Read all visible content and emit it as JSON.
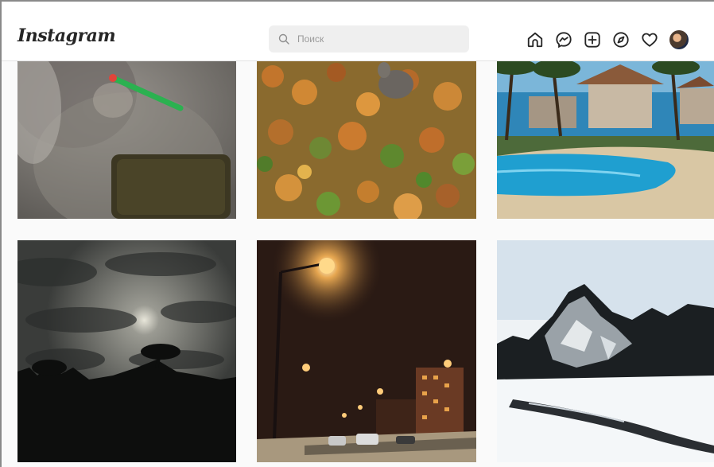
{
  "header": {
    "logo_text": "Instagram",
    "search_placeholder": "Поиск",
    "nav_icons": [
      "home-icon",
      "messenger-icon",
      "new-post-icon",
      "explore-icon",
      "activity-heart-icon",
      "profile-avatar"
    ]
  },
  "posts": [
    {
      "subject": "cat-with-pen"
    },
    {
      "subject": "autumn-leaves-squirrel"
    },
    {
      "subject": "tropical-pool-resort"
    },
    {
      "subject": "cloudy-night-sky-palms"
    },
    {
      "subject": "snowy-night-street"
    },
    {
      "subject": "snowy-rocky-hill-winter"
    }
  ],
  "colors": {
    "header_bg": "#ffffff",
    "page_bg": "#fafafa",
    "search_bg": "#efefef",
    "icon": "#262626"
  }
}
